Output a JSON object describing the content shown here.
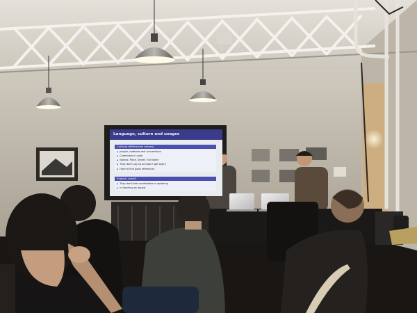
{
  "slide": {
    "title": "Language, culture and usages",
    "block1": {
      "heading": "Cultural differences among",
      "items": [
        "people, methods and conventions",
        "Comments in code",
        "Names: Place, Street, Full Name",
        "They don't say so and don't get angry",
        "Hard to find good references"
      ]
    },
    "block2": {
      "heading": "English, what?",
      "items": [
        "They don't feel comfortable in speaking",
        "In teaching as equals"
      ]
    }
  },
  "laptops": {
    "logo_glyph": ""
  },
  "colors": {
    "wall": "#cfc9bb",
    "screen": "#e9ecef",
    "slide_header": "#3b3b8c",
    "block_header": "#4b4fb0"
  }
}
